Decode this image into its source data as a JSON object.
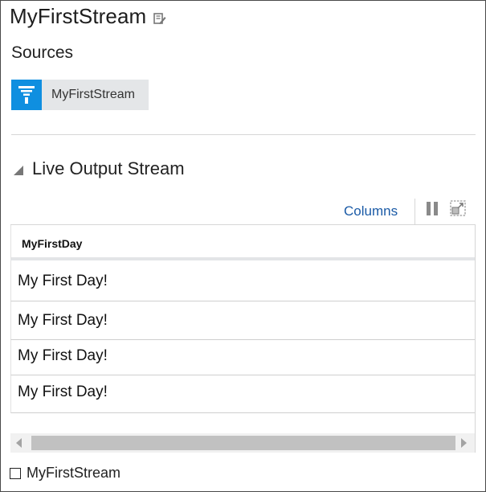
{
  "header": {
    "title": "MyFirstStream",
    "edit_icon": "edit-icon"
  },
  "sources": {
    "heading": "Sources",
    "items": [
      {
        "label": "MyFirstStream",
        "icon": "filter-icon",
        "icon_color": "#0f8fe0"
      }
    ]
  },
  "live_output": {
    "title": "Live Output Stream",
    "toolbar": {
      "columns_label": "Columns",
      "pause_icon": "pause-icon",
      "detach_icon": "detach-icon"
    },
    "table": {
      "columns": [
        "MyFirstDay"
      ],
      "rows": [
        [
          "My First Day!"
        ],
        [
          "My First Day!"
        ],
        [
          "My First Day!"
        ],
        [
          "My First Day!"
        ]
      ]
    }
  },
  "legend": {
    "label": "MyFirstStream"
  },
  "colors": {
    "accent": "#0f8fe0",
    "link": "#1a5aa6",
    "chip_bg": "#e4e6e8",
    "scroll_thumb": "#c1c1c1"
  }
}
